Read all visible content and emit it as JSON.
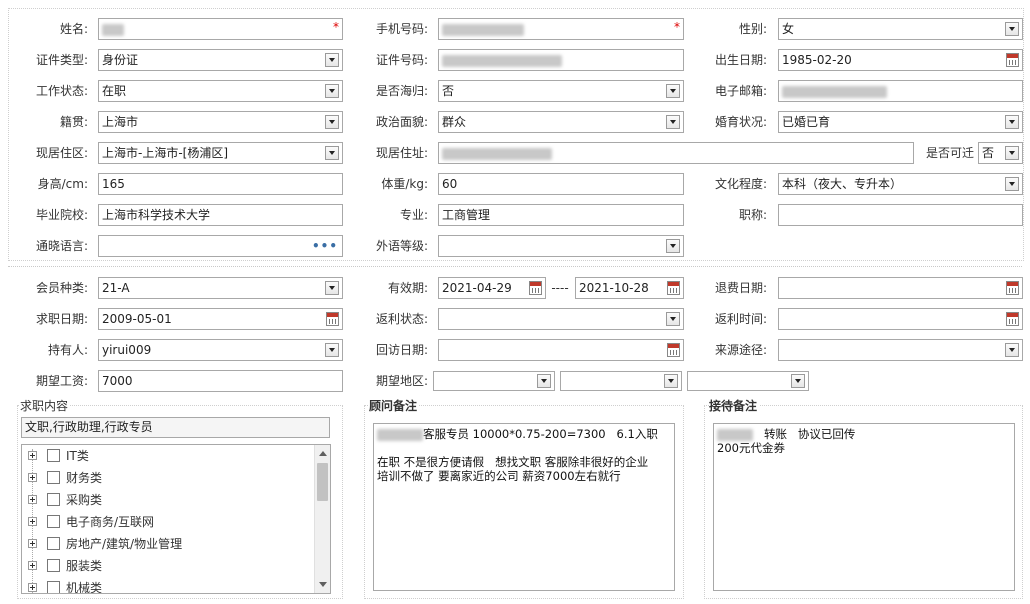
{
  "row1": {
    "name_label": "姓名:",
    "mobile_label": "手机号码:",
    "gender_label": "性别:",
    "gender_value": "女",
    "required_mark": "*"
  },
  "row2": {
    "id_type_label": "证件类型:",
    "id_type_value": "身份证",
    "id_no_label": "证件号码:",
    "birth_label": "出生日期:",
    "birth_value": "1985-02-20"
  },
  "row3": {
    "work_status_label": "工作状态:",
    "work_status_value": "在职",
    "returnee_label": "是否海归:",
    "returnee_value": "否",
    "email_label": "电子邮箱:"
  },
  "row4": {
    "native_label": "籍贯:",
    "native_value": "上海市",
    "political_label": "政治面貌:",
    "political_value": "群众",
    "marital_label": "婚育状况:",
    "marital_value": "已婚已育"
  },
  "row5": {
    "residence_area_label": "现居住区:",
    "residence_area_value": "上海市-上海市-[杨浦区]",
    "address_label": "现居住址:",
    "relocate_label": "是否可迁",
    "relocate_value": "否"
  },
  "row6": {
    "height_label": "身高/cm:",
    "height_value": "165",
    "weight_label": "体重/kg:",
    "weight_value": "60",
    "education_label": "文化程度:",
    "education_value": "本科（夜大、专升本）"
  },
  "row7": {
    "school_label": "毕业院校:",
    "school_value": "上海市科学技术大学",
    "major_label": "专业:",
    "major_value": "工商管理",
    "title_label": "职称:",
    "title_value": ""
  },
  "row8": {
    "language_label": "通晓语言:",
    "language_more": "•••",
    "foreign_level_label": "外语等级:"
  },
  "member": {
    "type_label": "会员种类:",
    "type_value": "21-A",
    "validity_label": "有效期:",
    "validity_start": "2021-04-29",
    "validity_sep": "----",
    "validity_end": "2021-10-28",
    "refund_date_label": "退费日期:",
    "job_date_label": "求职日期:",
    "job_date_value": "2009-05-01",
    "rebate_status_label": "返利状态:",
    "rebate_time_label": "返利时间:",
    "holder_label": "持有人:",
    "holder_value": "yirui009",
    "visit_date_label": "回访日期:",
    "source_label": "来源途径:",
    "salary_label": "期望工资:",
    "salary_value": "7000",
    "region_label": "期望地区:"
  },
  "job_content": {
    "title": "求职内容",
    "selected": "文职,行政助理,行政专员",
    "tree": [
      "IT类",
      "财务类",
      "采购类",
      "电子商务/互联网",
      "房地产/建筑/物业管理",
      "服装类",
      "机械类"
    ]
  },
  "advisor_notes": {
    "title": "顾问备注",
    "text": "客服专员 10000*0.75-200=7300   6.1入职\n\n在职 不是很方便请假   想找文职 客服除非很好的企业\n培训不做了 要离家近的公司 薪资7000左右就行"
  },
  "reception_notes": {
    "title": "接待备注",
    "line1": "转账   协议已回传",
    "line2": "200元代金券"
  },
  "colors": {
    "required": "#dd0000",
    "border": "#a8a8a8",
    "icon_blue": "#3a6ea5"
  }
}
